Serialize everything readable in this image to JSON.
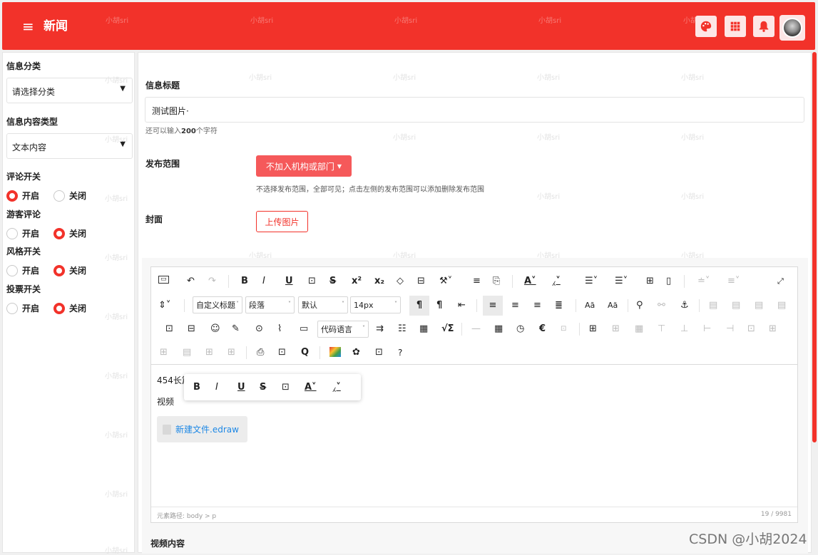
{
  "header": {
    "menu_icon": "≡",
    "title": "新闻",
    "icons": [
      "palette-icon",
      "grid-icon",
      "bell-icon"
    ],
    "accent": "#f2322a"
  },
  "watermark": "小胡sri",
  "sidebar": {
    "category_label": "信息分类",
    "category_value": "请选择分类",
    "content_type_label": "信息内容类型",
    "content_type_value": "文本内容",
    "groups": [
      {
        "label": "评论开关",
        "on": "开启",
        "off": "关闭",
        "selected": "on"
      },
      {
        "label": "游客评论",
        "on": "开启",
        "off": "关闭",
        "selected": "off"
      },
      {
        "label": "风格开关",
        "on": "开启",
        "off": "关闭",
        "selected": "off"
      },
      {
        "label": "投票开关",
        "on": "开启",
        "off": "关闭",
        "selected": "off"
      }
    ]
  },
  "form": {
    "title_label": "信息标题",
    "title_value": "测试图片·",
    "hint_pre": "还可以输入",
    "hint_num": "200",
    "hint_post": "个字符",
    "scope_label": "发布范围",
    "scope_button": "不加入机构或部门",
    "scope_hint": "不选择发布范围，全部可见；点击左侧的发布范围可以添加删除发布范围",
    "cover_label": "封面",
    "cover_button": "上传图片",
    "video_label": "视频内容"
  },
  "editor": {
    "dropdowns": [
      "自定义标题",
      "段落",
      "默认",
      "14px",
      "代码语言"
    ],
    "content_line1": "454长篇",
    "content_line2": "视频",
    "attachment": "新建文件.edraw",
    "path": "元素路径: body > p",
    "count": "19 / 9981"
  },
  "footer_credit": "CSDN @小胡2024"
}
